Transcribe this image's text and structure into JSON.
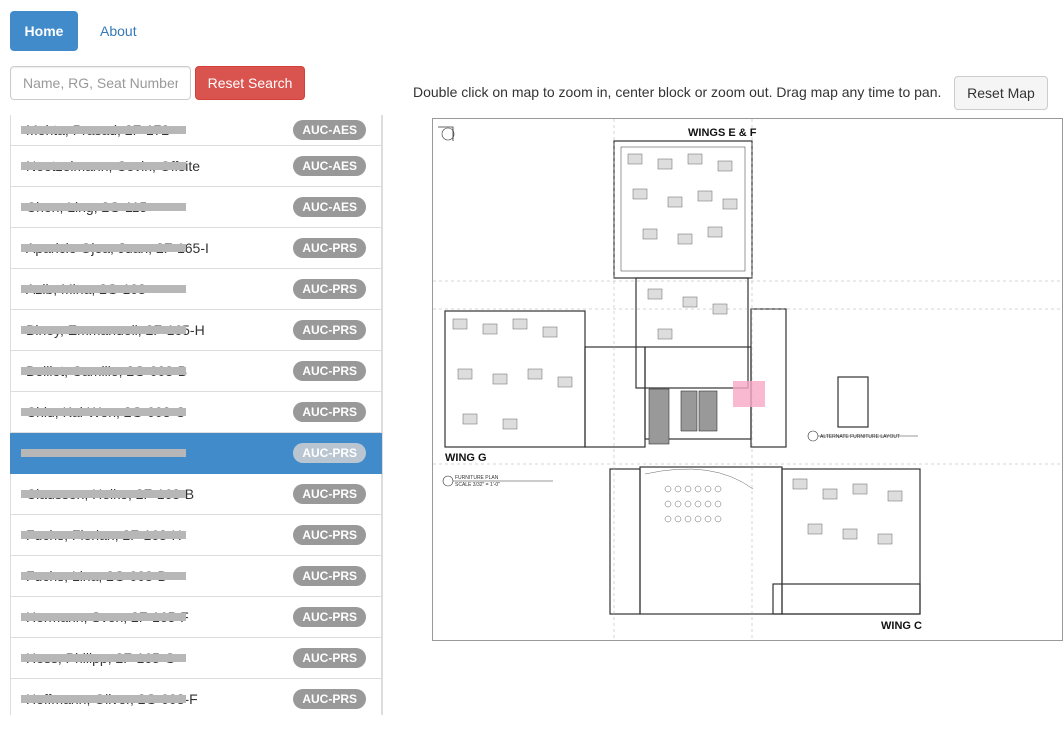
{
  "nav": {
    "home": "Home",
    "about": "About"
  },
  "search": {
    "placeholder": "Name, RG, Seat Number",
    "reset_label": "Reset Search"
  },
  "instructions": "Double click on map to zoom in, center block or zoom out. Drag map any time to pan.",
  "reset_map_label": "Reset Map",
  "people": [
    {
      "name": "Mehta, Prasad, 2F-172",
      "badge": "AUC-AES"
    },
    {
      "name": "Neetzelmann, Cevin, Offsite",
      "badge": "AUC-AES"
    },
    {
      "name": "Chen, Ling, 2G-115",
      "badge": "AUC-AES"
    },
    {
      "name": "Aparicio Ojea, Juan, 2F-165-I",
      "badge": "AUC-PRS"
    },
    {
      "name": "Azib, Mina, 2G-103",
      "badge": "AUC-PRS"
    },
    {
      "name": "Biney, Emmanuell, 2F-165-H",
      "badge": "AUC-PRS"
    },
    {
      "name": "Boillot, Camille, 2G-003-B",
      "badge": "AUC-PRS"
    },
    {
      "name": "Chiu, Kai-Wen, 2G-003-C",
      "badge": "AUC-PRS"
    },
    {
      "name": "Lin, Ming, 2G-003",
      "badge": "AUC-PRS"
    },
    {
      "name": "Claussen, Heiko, 2F-163-B",
      "badge": "AUC-PRS"
    },
    {
      "name": "Fuchs, Florian, 2F-163-H",
      "badge": "AUC-PRS"
    },
    {
      "name": "Fuchs, Lina, 2G-003-D",
      "badge": "AUC-PRS"
    },
    {
      "name": "Hermann, Sven, 2F-165-F",
      "badge": "AUC-PRS"
    },
    {
      "name": "Hess, Philipp, 2F-165-G",
      "badge": "AUC-PRS"
    },
    {
      "name": "Hoffmann, Oliver, 2G-003-F",
      "badge": "AUC-PRS"
    }
  ],
  "map": {
    "label_wings_ef": "WINGS E & F",
    "label_wing_g": "WING G",
    "label_wing_c": "WING C",
    "label_alt": "ALTERNATE FURNITURE LAYOUT",
    "label_plan": "FURNITURE PLAN",
    "label_scale": "SCALE 3/32\" = 1'-0\"",
    "highlight_color": "#f7a8c6"
  }
}
